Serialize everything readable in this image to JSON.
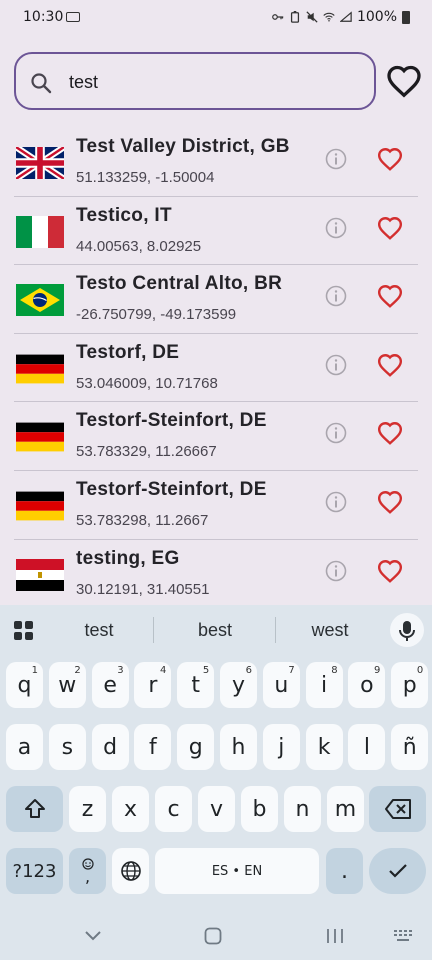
{
  "status": {
    "time": "10:30",
    "battery": "100%"
  },
  "search": {
    "value": "test"
  },
  "results": [
    {
      "name": "Test Valley District, GB",
      "coords": "51.133259, -1.50004",
      "country": "GB"
    },
    {
      "name": "Testico, IT",
      "coords": "44.00563, 8.02925",
      "country": "IT"
    },
    {
      "name": "Testo Central Alto, BR",
      "coords": "-26.750799, -49.173599",
      "country": "BR"
    },
    {
      "name": "Testorf, DE",
      "coords": "53.046009, 10.71768",
      "country": "DE"
    },
    {
      "name": "Testorf-Steinfort, DE",
      "coords": "53.783329, 11.26667",
      "country": "DE"
    },
    {
      "name": "Testorf-Steinfort, DE",
      "coords": "53.783298, 11.2667",
      "country": "DE"
    },
    {
      "name": "testing, EG",
      "coords": "30.12191, 31.40551",
      "country": "EG"
    }
  ],
  "keyboard": {
    "suggestions": [
      "test",
      "best",
      "west"
    ],
    "row1": [
      "q",
      "w",
      "e",
      "r",
      "t",
      "y",
      "u",
      "i",
      "o",
      "p"
    ],
    "row1_nums": [
      "1",
      "2",
      "3",
      "4",
      "5",
      "6",
      "7",
      "8",
      "9",
      "0"
    ],
    "row2": [
      "a",
      "s",
      "d",
      "f",
      "g",
      "h",
      "j",
      "k",
      "l",
      "ñ"
    ],
    "row3": [
      "z",
      "x",
      "c",
      "v",
      "b",
      "n",
      "m"
    ],
    "symbols_label": "?123",
    "emoji_comma": ",",
    "space_label": "ES • EN",
    "period": "."
  },
  "colors": {
    "accent": "#6c5596",
    "heart": "#d32f2f",
    "background": "#ede7ef"
  }
}
